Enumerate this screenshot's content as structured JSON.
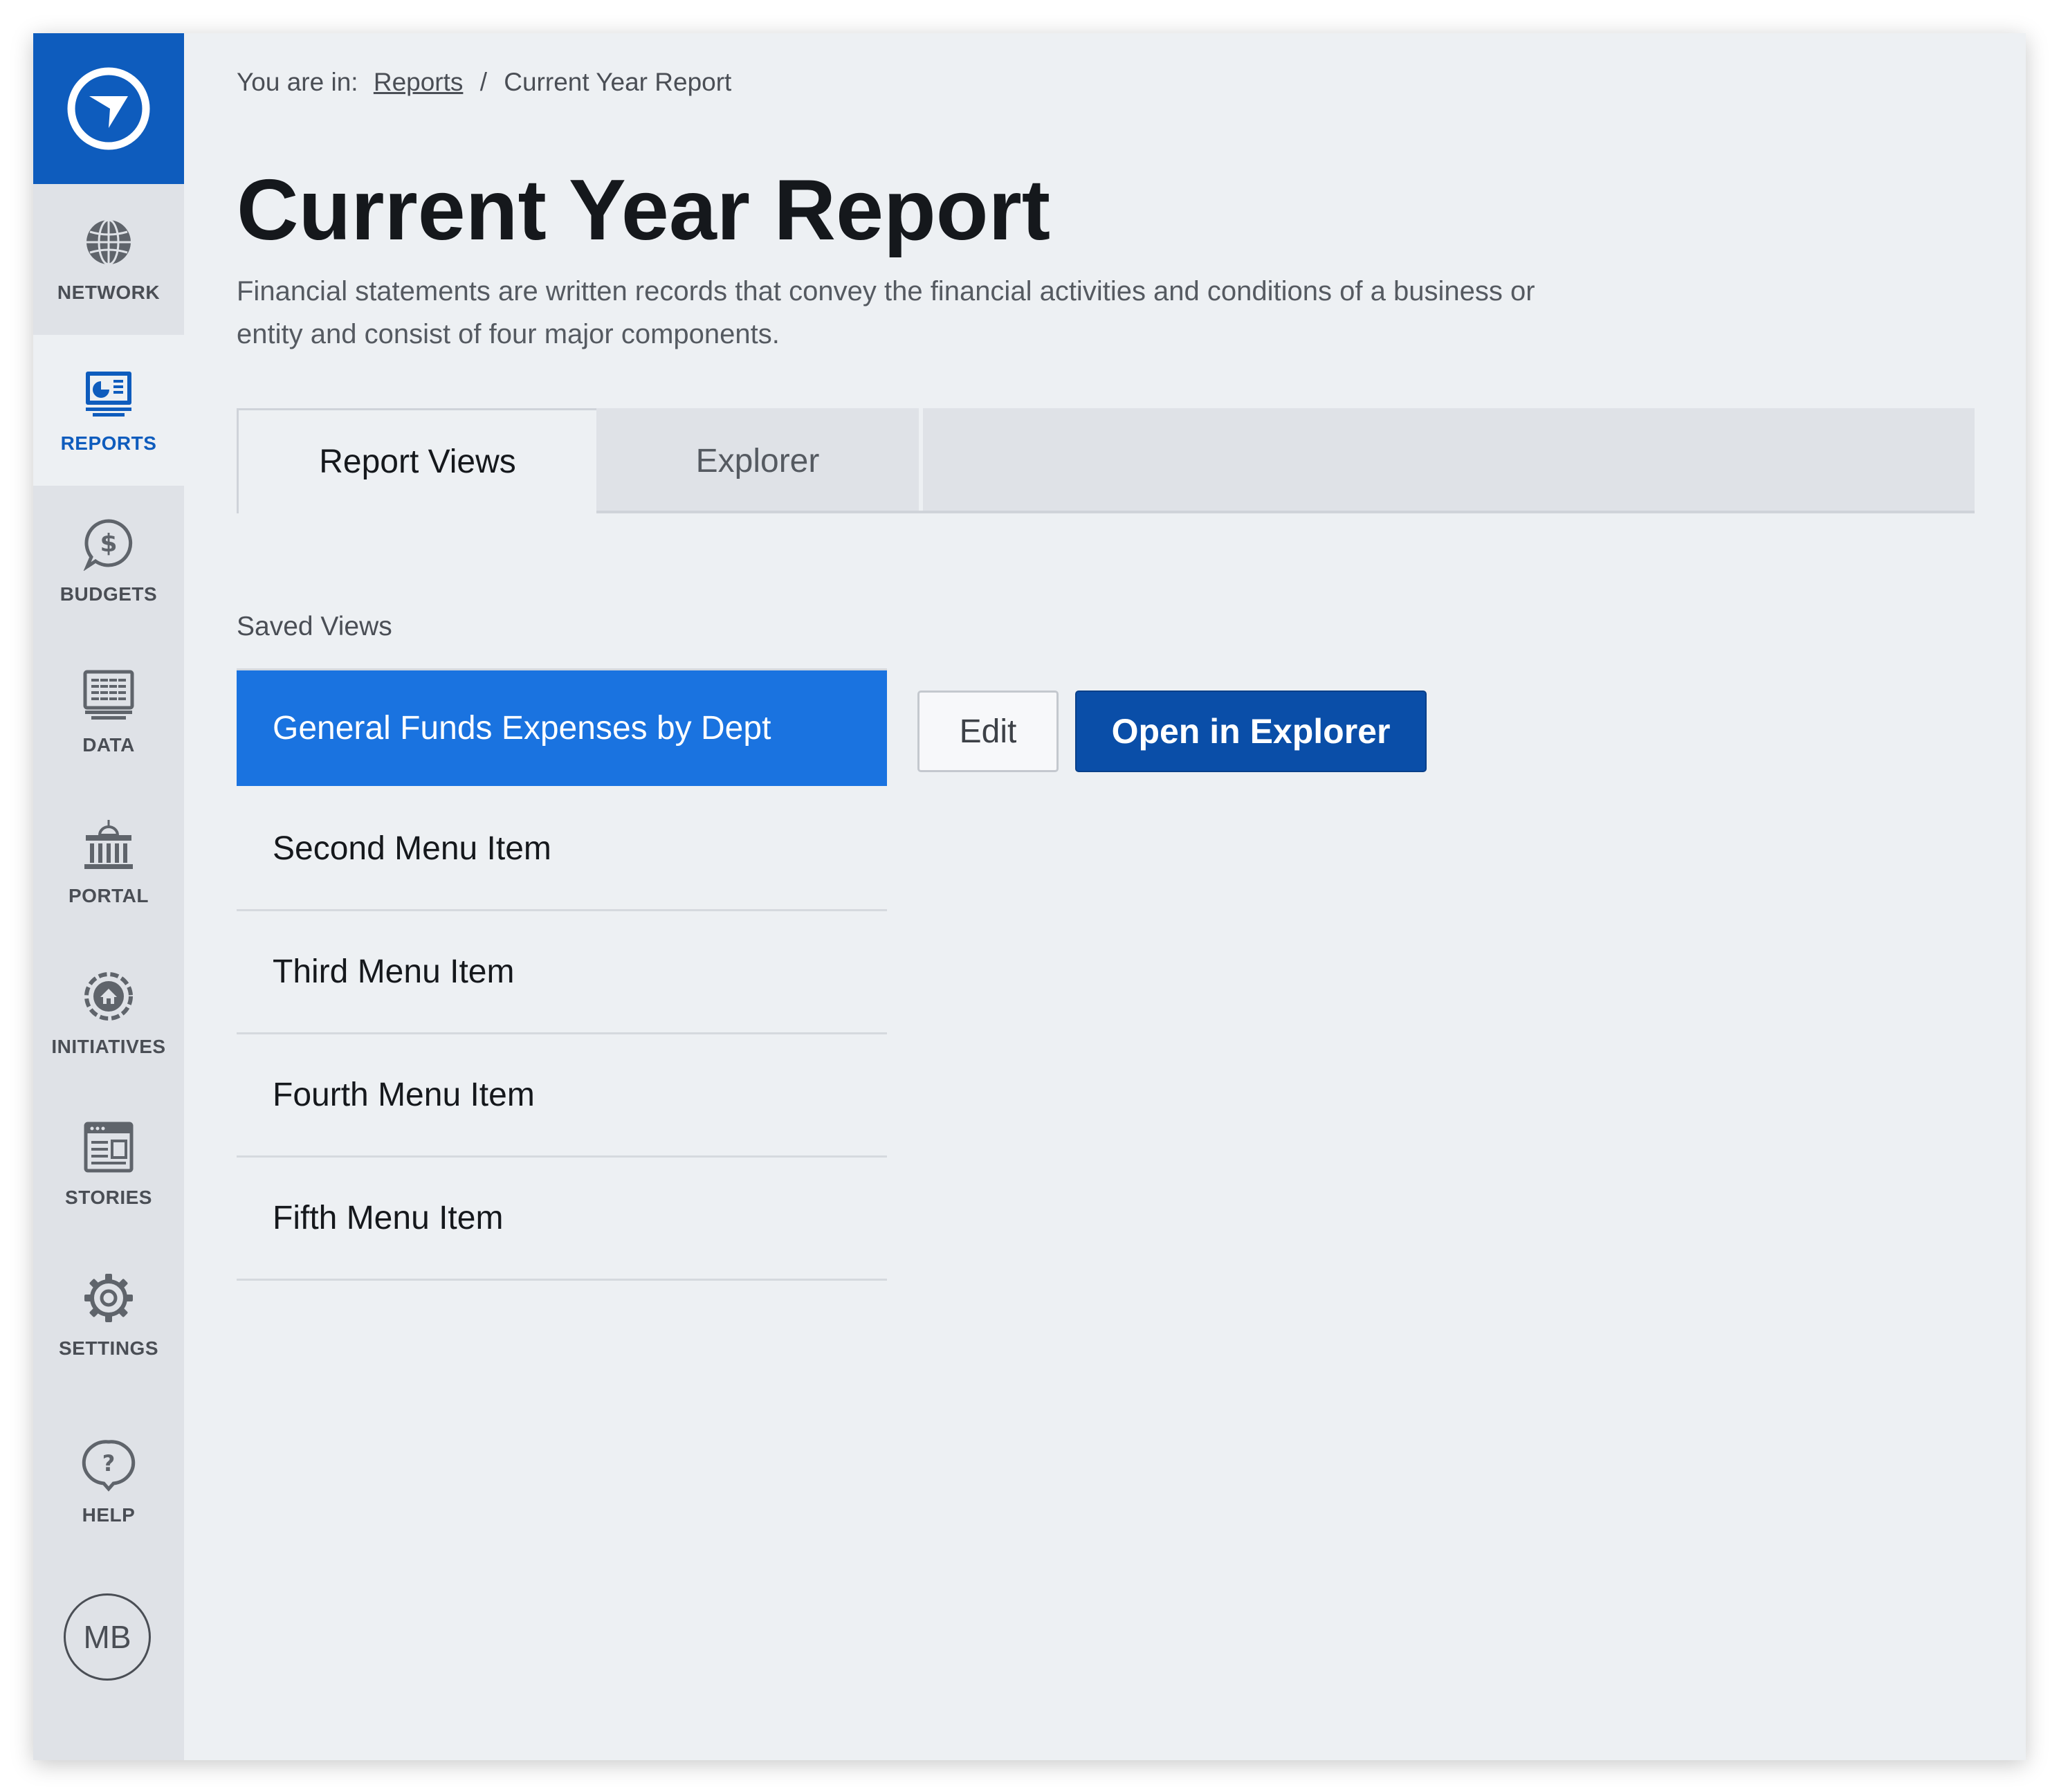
{
  "sidebar": {
    "logo": "compass-logo",
    "items": [
      {
        "label": "NETWORK",
        "icon": "globe-icon"
      },
      {
        "label": "REPORTS",
        "icon": "report-chart-icon",
        "active": true
      },
      {
        "label": "BUDGETS",
        "icon": "dollar-bubble-icon"
      },
      {
        "label": "DATA",
        "icon": "data-grid-icon"
      },
      {
        "label": "PORTAL",
        "icon": "building-icon"
      },
      {
        "label": "INITIATIVES",
        "icon": "initiative-target-icon"
      },
      {
        "label": "STORIES",
        "icon": "story-page-icon"
      },
      {
        "label": "SETTINGS",
        "icon": "gear-icon"
      },
      {
        "label": "HELP",
        "icon": "question-bubble-icon"
      }
    ],
    "avatar_initials": "MB"
  },
  "breadcrumb": {
    "prefix": "You are in:",
    "link": "Reports",
    "separator": "/",
    "current": "Current Year Report"
  },
  "page": {
    "title": "Current Year Report",
    "description": "Financial statements are written records that convey the financial activities and conditions of a business or entity and consist of four major components."
  },
  "tabs": [
    {
      "label": "Report Views",
      "active": true
    },
    {
      "label": "Explorer",
      "active": false
    }
  ],
  "saved_views": {
    "label": "Saved Views",
    "items": [
      {
        "label": "General Funds Expenses by Dept",
        "selected": true
      },
      {
        "label": "Second Menu Item"
      },
      {
        "label": "Third Menu Item"
      },
      {
        "label": "Fourth Menu Item"
      },
      {
        "label": "Fifth Menu Item"
      }
    ]
  },
  "actions": {
    "edit_label": "Edit",
    "open_label": "Open in Explorer"
  },
  "colors": {
    "brand_blue": "#0e5cbd",
    "selected_blue": "#1a73e0",
    "primary_button": "#0a4ea8",
    "background": "#edf0f3",
    "sidebar": "#dfe2e7"
  }
}
